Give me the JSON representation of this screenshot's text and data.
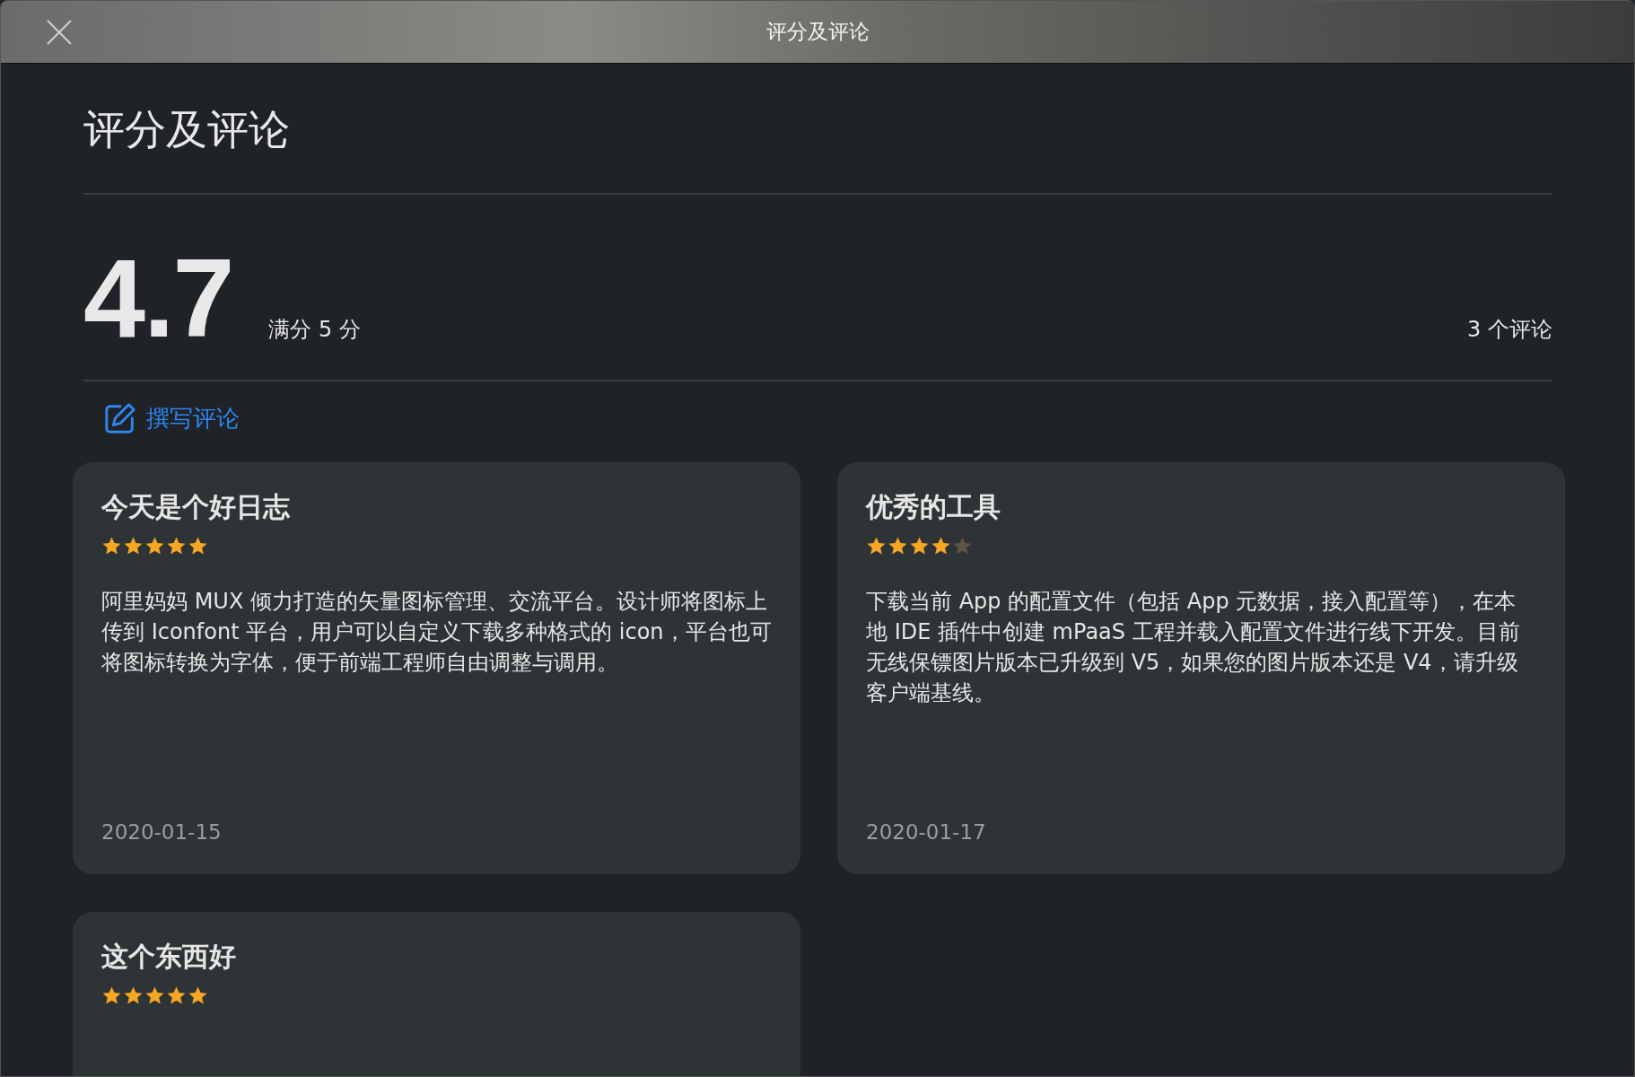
{
  "window": {
    "title": "评分及评论"
  },
  "heading": "评分及评论",
  "summary": {
    "rating": "4.7",
    "out_of": "满分 5 分",
    "review_count": "3 个评论"
  },
  "write_review": "撰写评论",
  "reviews": [
    {
      "title": "今天是个好日志",
      "stars": 5,
      "body": "阿里妈妈 MUX 倾力打造的矢量图标管理、交流平台。设计师将图标上传到 Iconfont 平台，用户可以自定义下载多种格式的 icon，平台也可将图标转换为字体，便于前端工程师自由调整与调用。",
      "date": "2020-01-15"
    },
    {
      "title": "优秀的工具",
      "stars": 4,
      "body": "下载当前 App 的配置文件（包括 App 元数据，接入配置等），在本地 IDE 插件中创建 mPaaS 工程并载入配置文件进行线下开发。目前无线保镖图片版本已升级到 V5，如果您的图片版本还是 V4，请升级客户端基线。",
      "date": "2020-01-17"
    },
    {
      "title": "这个东西好",
      "stars": 5
    }
  ]
}
